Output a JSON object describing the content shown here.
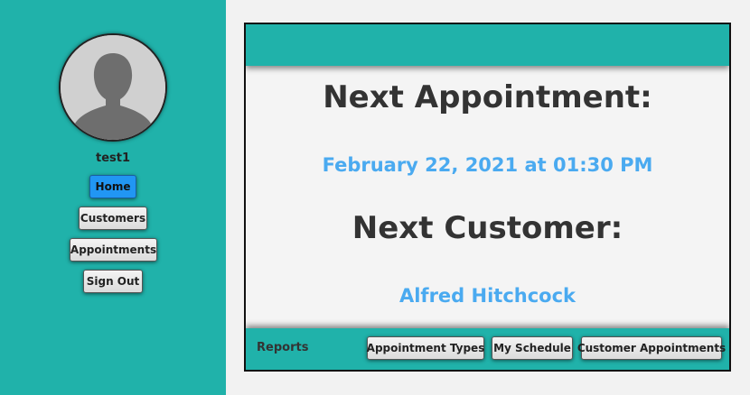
{
  "sidebar": {
    "username": "test1",
    "nav": {
      "home": "Home",
      "customers": "Customers",
      "appointments": "Appointments",
      "sign_out": "Sign Out"
    }
  },
  "main": {
    "next_appointment_heading": "Next Appointment:",
    "next_appointment_value": "February 22, 2021 at 01:30 PM",
    "next_customer_heading": "Next Customer:",
    "next_customer_value": "Alfred Hitchcock"
  },
  "footer": {
    "reports_label": "Reports",
    "buttons": {
      "appointment_types": "Appointment Types",
      "my_schedule": "My Schedule",
      "customer_appointments": "Customer Appointments"
    }
  },
  "colors": {
    "teal": "#20b2aa",
    "active_button": "#2196f3",
    "value_text": "#4aaaf0",
    "heading_text": "#333333"
  }
}
